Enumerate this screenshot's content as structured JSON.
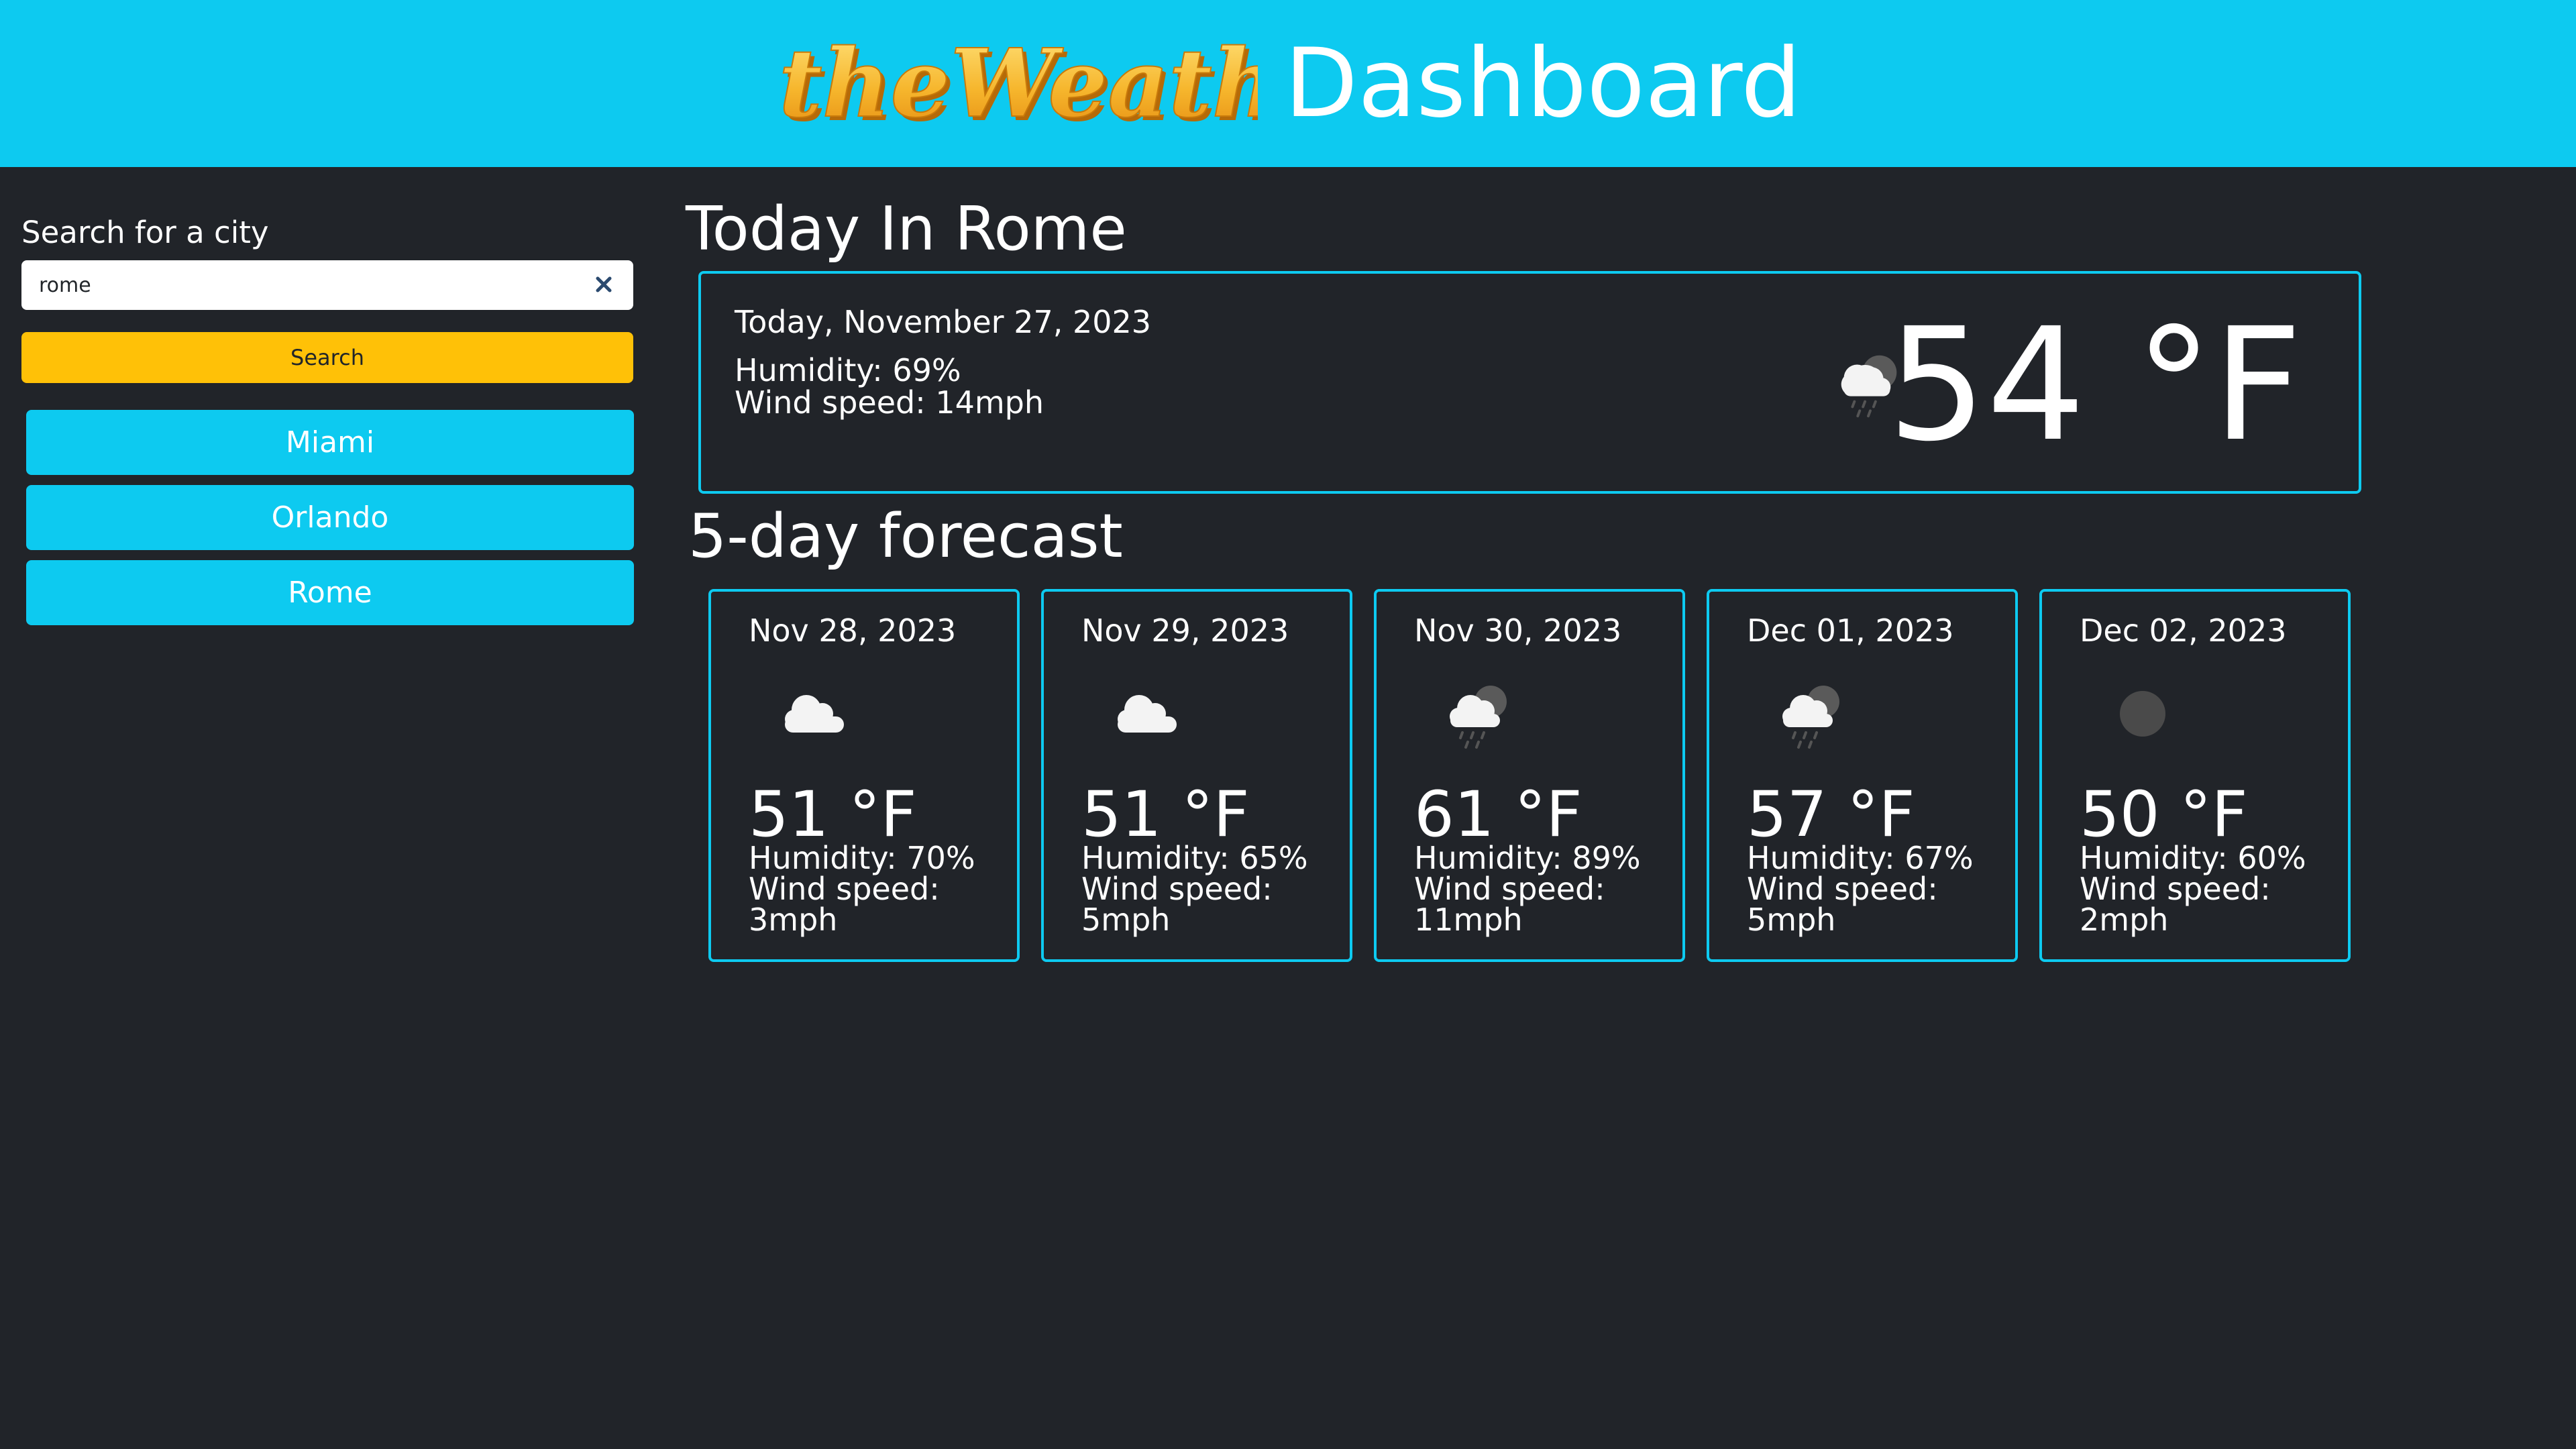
{
  "header": {
    "logo_text": "theWeather",
    "title": "Dashboard"
  },
  "search": {
    "label": "Search for a city",
    "value": "rome",
    "button_label": "Search"
  },
  "history": [
    "Miami",
    "Orlando",
    "Rome"
  ],
  "today": {
    "heading": "Today In Rome",
    "date": "Today, November 27, 2023",
    "humidity": "Humidity: 69%",
    "wind": "Wind speed: 14mph",
    "temp": "54 °F",
    "icon": "cloud-rain-night-icon"
  },
  "forecast": {
    "heading": "5-day forecast",
    "days": [
      {
        "date": "Nov 28, 2023",
        "temp": "51 °F",
        "humidity": "Humidity: 70%",
        "wind_label": "Wind speed:",
        "wind_value": "3mph",
        "icon": "cloud-icon"
      },
      {
        "date": "Nov 29, 2023",
        "temp": "51 °F",
        "humidity": "Humidity: 65%",
        "wind_label": "Wind speed:",
        "wind_value": "5mph",
        "icon": "cloud-icon"
      },
      {
        "date": "Nov 30, 2023",
        "temp": "61 °F",
        "humidity": "Humidity: 89%",
        "wind_label": "Wind speed:",
        "wind_value": "11mph",
        "icon": "cloud-rain-night-icon"
      },
      {
        "date": "Dec 01, 2023",
        "temp": "57 °F",
        "humidity": "Humidity: 67%",
        "wind_label": "Wind speed:",
        "wind_value": "5mph",
        "icon": "cloud-rain-night-icon"
      },
      {
        "date": "Dec 02, 2023",
        "temp": "50 °F",
        "humidity": "Humidity: 60%",
        "wind_label": "Wind speed:",
        "wind_value": "2mph",
        "icon": "moon-icon"
      }
    ]
  },
  "colors": {
    "accent": "#0dcaf0",
    "search_button": "#ffc107",
    "background": "#212429",
    "logo_gold": "#f5c542"
  }
}
